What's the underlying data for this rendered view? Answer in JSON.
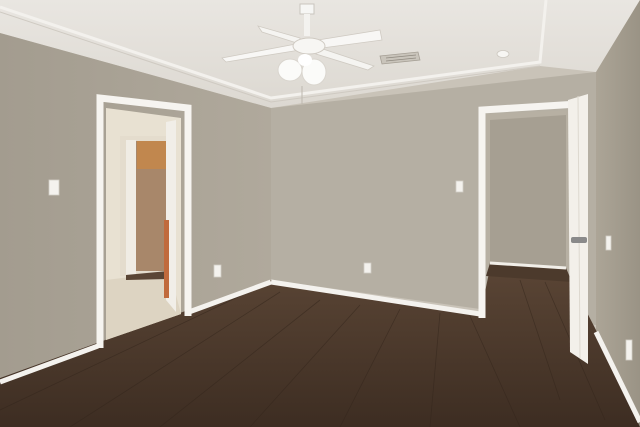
{
  "scene": {
    "colors": {
      "ceiling": "#e6e3de",
      "wall_left": "#aaa396",
      "wall_back": "#b5afa3",
      "wall_right": "#a59e91",
      "floor": "#4c3a2c",
      "trim": "#f4f2ee",
      "hall_wall": "#d8c9ad",
      "closet_accent": "#b87a44"
    },
    "icons": [
      "ceiling-fan-icon",
      "air-vent-icon",
      "smoke-detector-icon",
      "light-switch-icon",
      "outlet-icon"
    ]
  }
}
